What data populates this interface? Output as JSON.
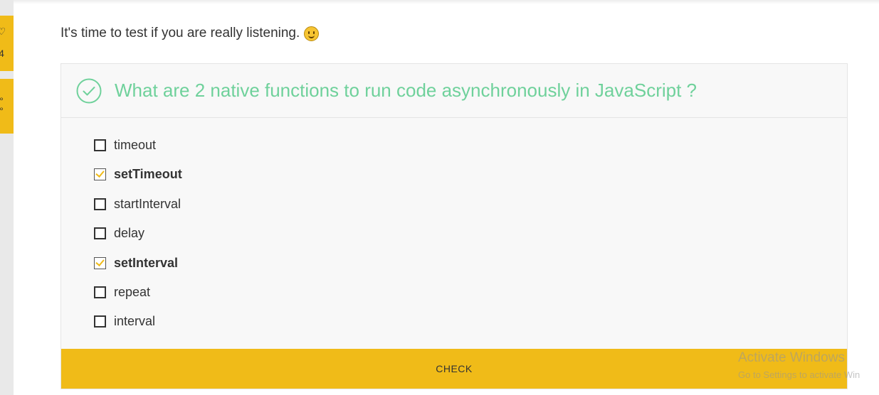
{
  "rail": {
    "tabs": [
      {
        "icon": "chat-bubble-icon",
        "glyph_top": "♡",
        "glyph_bottom": "4"
      },
      {
        "icon": "share-icon",
        "glyph_top": "°",
        "glyph_bottom": "°"
      }
    ]
  },
  "intro": {
    "text": "It's time to test if you are really listening.",
    "emoji": "winking-smiley-icon"
  },
  "quiz": {
    "status_icon": "check-circle-icon",
    "question": "What are 2 native functions to run code asynchronously in JavaScript ?",
    "options": [
      {
        "label": "timeout",
        "checked": false
      },
      {
        "label": "setTimeout",
        "checked": true
      },
      {
        "label": "startInterval",
        "checked": false
      },
      {
        "label": "delay",
        "checked": false
      },
      {
        "label": "setInterval",
        "checked": true
      },
      {
        "label": "repeat",
        "checked": false
      },
      {
        "label": "interval",
        "checked": false
      }
    ],
    "check_label": "CHECK"
  },
  "watermark": {
    "title": "Activate Windows",
    "subtitle": "Go to Settings to activate Win"
  },
  "colors": {
    "accent": "#f0bb18",
    "question": "#6fd19b"
  }
}
